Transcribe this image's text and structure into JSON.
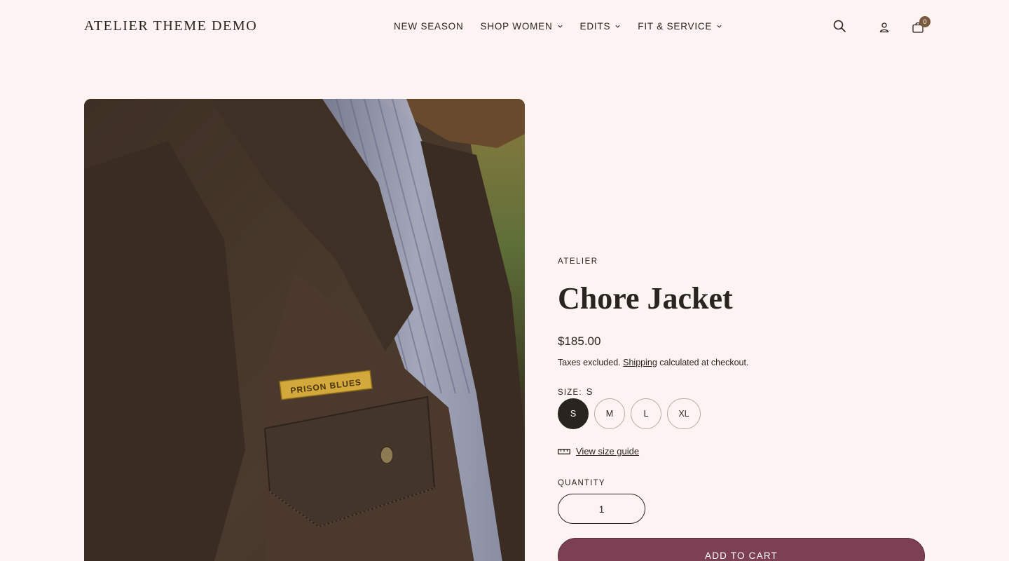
{
  "header": {
    "logo": "ATELIER THEME DEMO",
    "nav": [
      {
        "label": "NEW SEASON",
        "has_dropdown": false
      },
      {
        "label": "SHOP WOMEN",
        "has_dropdown": true
      },
      {
        "label": "EDITS",
        "has_dropdown": true
      },
      {
        "label": "FIT & SERVICE",
        "has_dropdown": true
      }
    ],
    "icons": [
      "search-icon",
      "account-icon",
      "cart-icon"
    ],
    "cart_count": "0"
  },
  "product": {
    "image_icon": "product-photo-chore-jacket",
    "patch_text": "PRISON BLUES",
    "vendor": "ATELIER",
    "title": "Chore Jacket",
    "price": "$185.00",
    "tax_prefix": "Taxes excluded.",
    "tax_link": "Shipping",
    "tax_suffix": "calculated at checkout.",
    "size_label": "SIZE:",
    "size_selected": "S",
    "sizes": [
      "S",
      "M",
      "L",
      "XL"
    ],
    "size_guide": "View size guide",
    "quantity_label": "QUANTITY",
    "quantity": "1",
    "add_to_cart": "ADD TO CART"
  },
  "colors": {
    "background": "#fcf4f2",
    "text": "#2a2420",
    "accent": "#7c3f54",
    "badge": "#7a5a3e"
  }
}
